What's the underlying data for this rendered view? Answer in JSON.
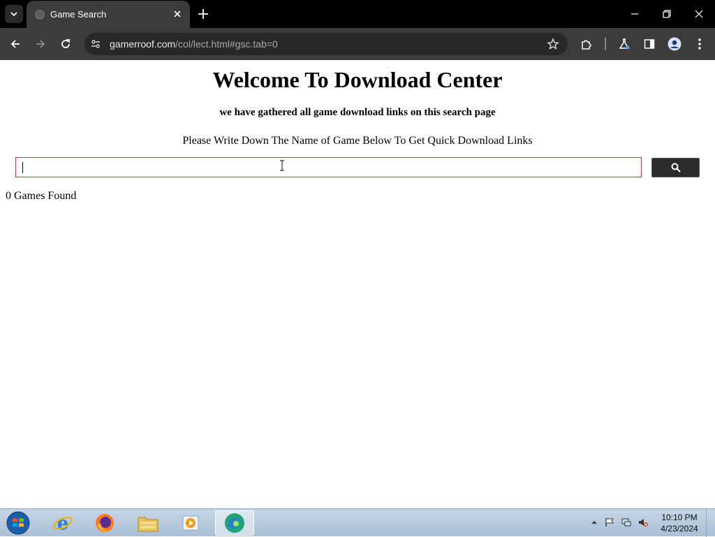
{
  "browser": {
    "tab_title": "Game Search",
    "url_domain": "gamerroof.com",
    "url_path": "/col/lect.html#gsc.tab=0"
  },
  "page": {
    "title": "Welcome To Download Center",
    "subtitle": "we have gathered all game download links on this search page",
    "instructions": "Please Write Down The Name of Game Below To Get Quick Download Links",
    "search_value": "",
    "results_count": "0 Games Found"
  },
  "taskbar": {
    "items": [
      "start-orb-icon",
      "internet-explorer-icon",
      "firefox-icon",
      "file-explorer-icon",
      "media-player-icon",
      "edge-icon"
    ],
    "clock_time": "10:10 PM",
    "clock_date": "4/23/2024"
  },
  "colors": {
    "tab_bar": "#000000",
    "toolbar": "#3b3b3b",
    "search_border": "#dd3333",
    "search_button": "#2b2b2b"
  }
}
